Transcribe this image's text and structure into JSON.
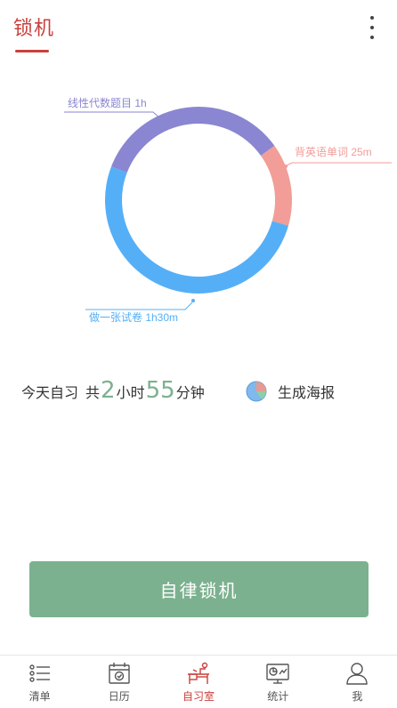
{
  "header": {
    "title": "锁机"
  },
  "chart_data": {
    "type": "pie",
    "style": "donut",
    "slices": [
      {
        "label": "线性代数题目 1h",
        "minutes": 60,
        "color": "#8a86d1"
      },
      {
        "label": "背英语单词 25m",
        "minutes": 25,
        "color": "#f29d97"
      },
      {
        "label": "做一张试卷 1h30m",
        "minutes": 90,
        "color": "#55aff7"
      }
    ]
  },
  "stats": {
    "prefix": "今天自习",
    "total_label": "共",
    "hours": "2",
    "hours_unit": "小时",
    "minutes": "55",
    "minutes_unit": "分钟"
  },
  "poster": {
    "label": "生成海报"
  },
  "lock_button": {
    "label": "自律锁机"
  },
  "tabs": [
    {
      "label": "清单",
      "icon": "list-icon",
      "active": false
    },
    {
      "label": "日历",
      "icon": "calendar-icon",
      "active": false
    },
    {
      "label": "自习室",
      "icon": "study-room-icon",
      "active": true
    },
    {
      "label": "统计",
      "icon": "stats-icon",
      "active": false
    },
    {
      "label": "我",
      "icon": "profile-icon",
      "active": false
    }
  ]
}
